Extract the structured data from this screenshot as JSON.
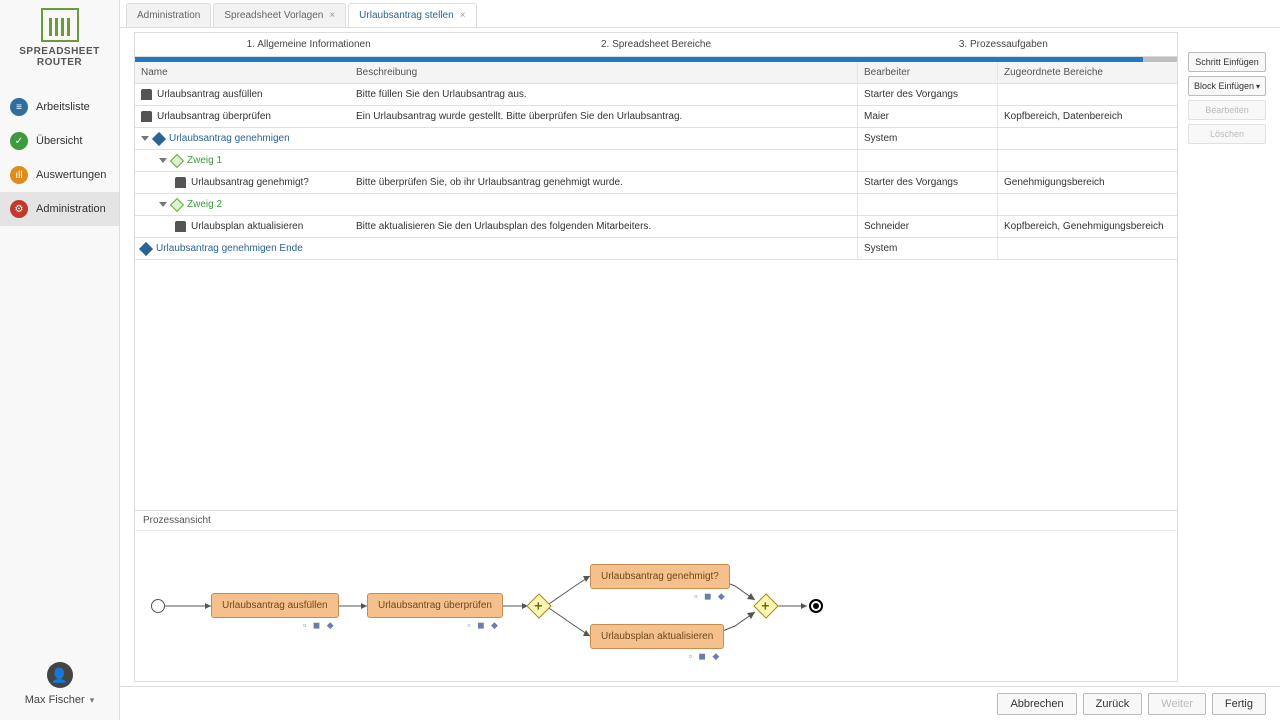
{
  "sidebar": {
    "brand1": "SPREADSHEET",
    "brand2": "ROUTER",
    "items": [
      {
        "label": "Arbeitsliste",
        "icon": "list-icon",
        "cls": "bg-blue",
        "glyph": "≡"
      },
      {
        "label": "Übersicht",
        "icon": "check-icon",
        "cls": "bg-green",
        "glyph": "✓"
      },
      {
        "label": "Auswertungen",
        "icon": "bars-icon",
        "cls": "bg-orange",
        "glyph": "ıll"
      },
      {
        "label": "Administration",
        "icon": "gear-icon",
        "cls": "bg-red",
        "glyph": "⚙",
        "active": true
      }
    ],
    "user": "Max Fischer"
  },
  "tabs": [
    {
      "label": "Administration",
      "closeable": false
    },
    {
      "label": "Spreadsheet Vorlagen",
      "closeable": true
    },
    {
      "label": "Urlaubsantrag stellen",
      "closeable": true,
      "active": true
    }
  ],
  "wizard": {
    "steps": [
      "1. Allgemeine Informationen",
      "2. Spreadsheet Bereiche",
      "3. Prozessaufgaben"
    ],
    "active_index": 2
  },
  "actions": {
    "insert_step": "Schritt Einfügen",
    "insert_block": "Block Einfügen",
    "edit": "Bearbeiten",
    "delete": "Löschen"
  },
  "table": {
    "headers": {
      "name": "Name",
      "desc": "Beschreibung",
      "bear": "Bearbeiter",
      "zuge": "Zugeordnete Bereiche"
    },
    "rows": [
      {
        "icon": "user",
        "indent": 0,
        "name": "Urlaubsantrag ausfüllen",
        "desc": "Bitte füllen Sie den Urlaubsantrag aus.",
        "bear": "Starter des Vorgangs",
        "zuge": ""
      },
      {
        "icon": "user",
        "indent": 0,
        "name": "Urlaubsantrag überprüfen",
        "desc": "Ein Urlaubsantrag wurde gestellt. Bitte überprüfen Sie den Urlaubsantrag.",
        "bear": "Maier",
        "zuge": "Kopfbereich, Datenbereich"
      },
      {
        "icon": "diamond",
        "indent": 0,
        "name": "Urlaubsantrag genehmigen",
        "name_cls": "blue-link",
        "desc": "",
        "bear": "System",
        "zuge": "",
        "expand": true
      },
      {
        "icon": "split",
        "indent": 1,
        "name": "Zweig 1",
        "name_cls": "green-link",
        "desc": "",
        "bear": "",
        "zuge": "",
        "expand": true
      },
      {
        "icon": "user",
        "indent": 2,
        "name": "Urlaubsantrag genehmigt?",
        "desc": "Bitte überprüfen Sie, ob ihr Urlaubsantrag genehmigt wurde.",
        "bear": "Starter des Vorgangs",
        "zuge": "Genehmigungsbereich"
      },
      {
        "icon": "split",
        "indent": 1,
        "name": "Zweig 2",
        "name_cls": "green-link",
        "desc": "",
        "bear": "",
        "zuge": "",
        "expand": true
      },
      {
        "icon": "user",
        "indent": 2,
        "name": "Urlaubsplan aktualisieren",
        "desc": "Bitte aktualisieren Sie den Urlaubsplan des folgenden Mitarbeiters.",
        "bear": "Schneider",
        "zuge": "Kopfbereich, Genehmigungsbereich"
      },
      {
        "icon": "diamond",
        "indent": 0,
        "name": "Urlaubsantrag genehmigen Ende",
        "name_cls": "blue-link",
        "desc": "",
        "bear": "System",
        "zuge": ""
      }
    ]
  },
  "process": {
    "title": "Prozessansicht",
    "nodes": {
      "n1": "Urlaubsantrag ausfüllen",
      "n2": "Urlaubsantrag überprüfen",
      "n3": "Urlaubsantrag genehmigt?",
      "n4": "Urlaubsplan aktualisieren"
    }
  },
  "footer": {
    "cancel": "Abbrechen",
    "back": "Zurück",
    "next": "Weiter",
    "finish": "Fertig"
  }
}
